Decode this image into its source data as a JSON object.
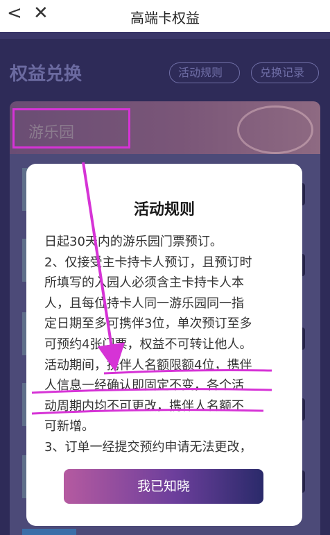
{
  "window": {
    "title": "高端卡权益"
  },
  "page": {
    "section_title": "权益兑换",
    "rules_button": "活动规则",
    "records_button": "兑换记录",
    "category_label": "游乐园"
  },
  "modal": {
    "title": "活动规则",
    "lines": [
      "日起30天内的游乐园门票预订。",
      "2、仅接受主卡持卡人预订，且预订时",
      "所填写的入园人必须含主卡持卡人本",
      "人，且每位持卡人同一游乐园同一指",
      "定日期至多可携伴3位，单次预订至多",
      "可预约4张门票，权益不可转让他人。",
      "活动期间，携伴人名额限额4位，携伴",
      "人信息一经确认即固定不变，各个活",
      "动周期内均不可更改，携伴人名额不",
      "可新增。",
      "3、订单一经提交预约申请无法更改，"
    ],
    "confirm_button": "我已知晓"
  },
  "icons": {
    "back": "chevron-left-icon",
    "close": "close-icon"
  },
  "colors": {
    "annotation": "#d633d6",
    "background": "#2e2b58"
  }
}
